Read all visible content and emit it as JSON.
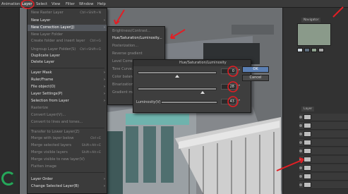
{
  "menubar": {
    "items": [
      "Animation",
      "Layer",
      "Select",
      "View",
      "Filter",
      "Window",
      "Help"
    ],
    "active": "Layer"
  },
  "layer_menu": {
    "items": [
      {
        "label": "New Raster Layer",
        "shortcut": "Ctrl+Shift+N",
        "state": "dim"
      },
      {
        "label": "New Layer",
        "shortcut": "",
        "state": "normal",
        "arrow": true
      },
      {
        "label": "New Correction Layer(J)",
        "shortcut": "",
        "state": "selected",
        "arrow": true
      },
      {
        "label": "New Layer Folder",
        "shortcut": "",
        "state": "dim"
      },
      {
        "label": "Create folder and insert layer",
        "shortcut": "Ctrl+G",
        "state": "dim"
      },
      {
        "label": "Ungroup Layer Folder(S)",
        "shortcut": "Ctrl+Shift+G",
        "state": "dim"
      },
      {
        "label": "Duplicate Layer",
        "shortcut": "",
        "state": "normal"
      },
      {
        "label": "Delete Layer",
        "shortcut": "",
        "state": "normal"
      },
      {
        "label": "Layer Mask",
        "shortcut": "",
        "state": "normal",
        "arrow": true
      },
      {
        "label": "Ruler/Frame",
        "shortcut": "",
        "state": "normal",
        "arrow": true
      },
      {
        "label": "File object(O)",
        "shortcut": "",
        "state": "normal",
        "arrow": true
      },
      {
        "label": "Layer Settings(P)",
        "shortcut": "",
        "state": "normal",
        "arrow": true
      },
      {
        "label": "Selection from Layer",
        "shortcut": "",
        "state": "normal",
        "arrow": true
      },
      {
        "label": "Rasterize",
        "shortcut": "",
        "state": "dim"
      },
      {
        "label": "Convert Layer(V)...",
        "shortcut": "",
        "state": "dim"
      },
      {
        "label": "Convert to lines and tones...",
        "shortcut": "",
        "state": "dim"
      },
      {
        "label": "Transfer to Lower Layer(Z)",
        "shortcut": "",
        "state": "dim"
      },
      {
        "label": "Merge with layer below",
        "shortcut": "Ctrl+E",
        "state": "dim"
      },
      {
        "label": "Merge selected layers",
        "shortcut": "Shift+Alt+E",
        "state": "dim"
      },
      {
        "label": "Merge visible layers",
        "shortcut": "Shift+Alt+E",
        "state": "dim"
      },
      {
        "label": "Merge visible to new layer(V)",
        "shortcut": "",
        "state": "dim"
      },
      {
        "label": "Flatten image",
        "shortcut": "",
        "state": "dim"
      },
      {
        "label": "Layer Order",
        "shortcut": "",
        "state": "normal",
        "arrow": true
      },
      {
        "label": "Change Selected Layer(B)",
        "shortcut": "",
        "state": "normal",
        "arrow": true
      }
    ]
  },
  "sub_menu": {
    "items": [
      {
        "label": "Brightness/Contrast...",
        "highlight": false
      },
      {
        "label": "Hue/Saturation/Luminosity...",
        "highlight": true
      },
      {
        "label": "Posterization...",
        "highlight": false
      },
      {
        "label": "Reverse gradient",
        "highlight": false
      },
      {
        "label": "Level Correction...",
        "highlight": false
      },
      {
        "label": "Tone Curve...",
        "highlight": false
      },
      {
        "label": "Color balance...",
        "highlight": false
      },
      {
        "label": "Binarization...",
        "highlight": false
      },
      {
        "label": "Gradient map...",
        "highlight": false
      }
    ]
  },
  "dialog": {
    "title": "Hue/Saturation/Luminosity",
    "hue_value": "0",
    "saturation_value": "28",
    "luminosity_label": "Luminosity(V)",
    "luminosity_value": "43",
    "ok_label": "OK",
    "cancel_label": "Cancel"
  },
  "right_panel": {
    "navigator_tab": "Navigator",
    "layer_tab": "Layer"
  },
  "colors": {
    "accent": "#5b7fb3",
    "annotation_red": "#e31e24",
    "ring_green": "#25a85a"
  }
}
